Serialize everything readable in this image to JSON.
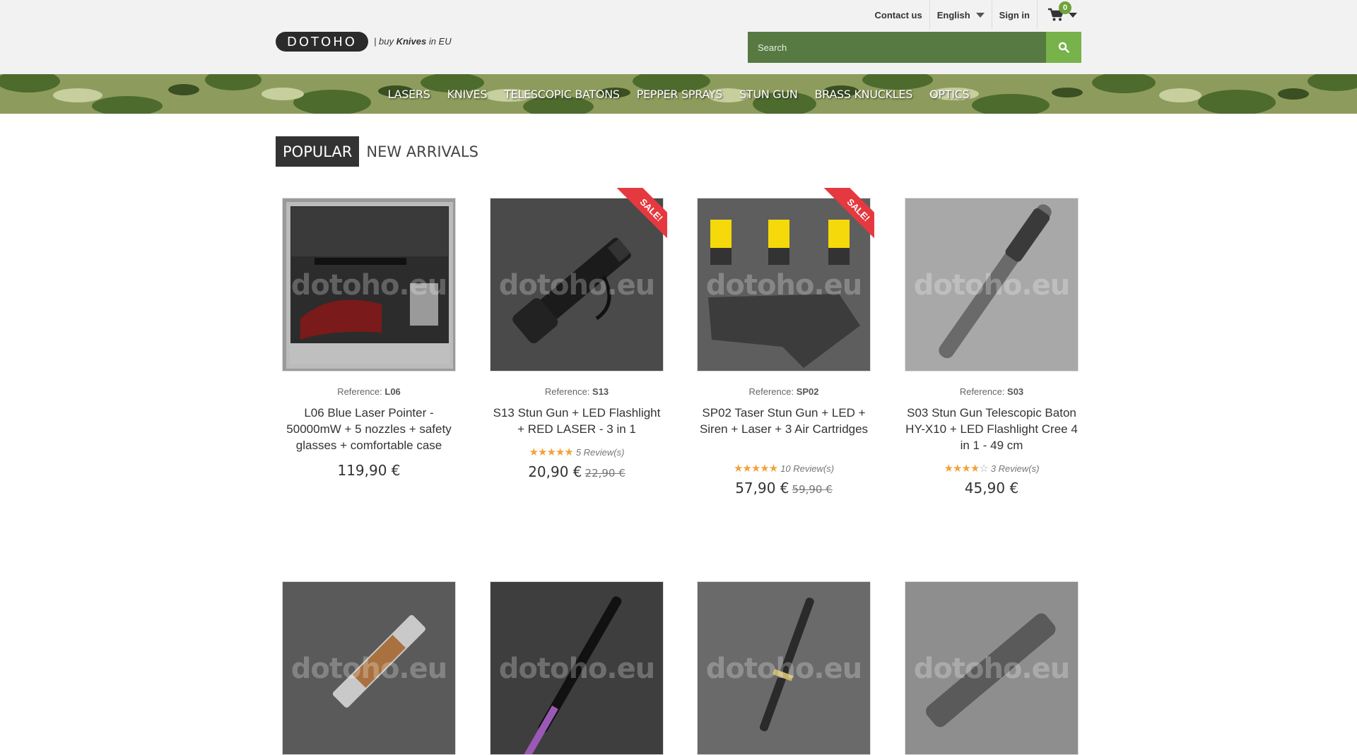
{
  "header": {
    "contact": "Contact us",
    "language": "English",
    "signin": "Sign in",
    "cart_count": "0",
    "logo": "DOTOHO",
    "tagline_prefix": "| buy ",
    "tagline_bold": "Knives",
    "tagline_suffix": " in EU",
    "search_placeholder": "Search"
  },
  "nav": [
    "LASERS",
    "KNIVES",
    "TELESCOPIC BATONS",
    "PEPPER SPRAYS",
    "STUN GUN",
    "BRASS KNUCKLES",
    "OPTICS"
  ],
  "tabs": {
    "popular": "POPULAR",
    "new_arrivals": "NEW ARRIVALS"
  },
  "colors": {
    "search_bg": "#567a41",
    "search_btn": "#77b24a",
    "sale": "#e5393f",
    "stars": "#f0a33a"
  },
  "watermark": "dotoho.eu",
  "products": [
    {
      "ref_label": "Reference: ",
      "ref": "L06",
      "name": "L06 Blue Laser Pointer - 50000mW + 5 nozzles + safety glasses + comfortable case",
      "price": "119,90 €",
      "old_price": "",
      "sale": false,
      "rating": 0,
      "reviews": ""
    },
    {
      "ref_label": "Reference: ",
      "ref": "S13",
      "name": "S13 Stun Gun + LED Flashlight + RED LASER - 3 in 1",
      "price": "20,90 €",
      "old_price": "22,90 €",
      "sale": true,
      "sale_label": "SALE!",
      "rating": 5,
      "reviews": "5 Review(s)"
    },
    {
      "ref_label": "Reference: ",
      "ref": "SP02",
      "name": "SP02 Taser Stun Gun + LED + Siren + Laser + 3 Air Cartridges",
      "price": "57,90 €",
      "old_price": "59,90 €",
      "sale": true,
      "sale_label": "SALE!",
      "rating": 5,
      "reviews": "10 Review(s)"
    },
    {
      "ref_label": "Reference: ",
      "ref": "S03",
      "name": "S03 Stun Gun Telescopic Baton HY-X10 + LED Flashlight Cree 4 in 1 - 49 cm",
      "price": "45,90 €",
      "old_price": "",
      "sale": false,
      "rating": 4,
      "reviews": "3 Review(s)"
    }
  ],
  "row2": [
    {
      "id": "knife-1"
    },
    {
      "id": "knife-2"
    },
    {
      "id": "knife-3"
    },
    {
      "id": "knife-4"
    }
  ]
}
